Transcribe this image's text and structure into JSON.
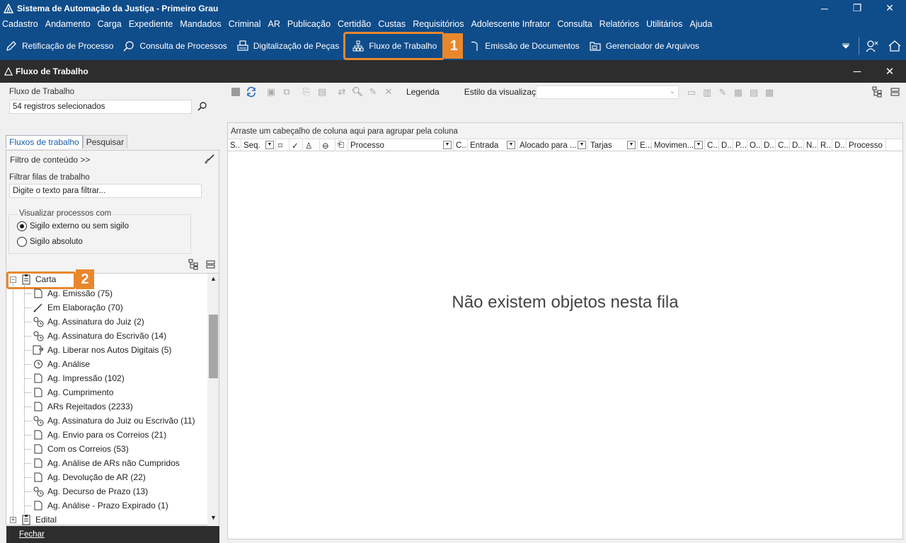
{
  "window": {
    "title": "Sistema de Automação da Justiça - Primeiro Grau",
    "minimize": "─",
    "restore": "❐",
    "close": "✕"
  },
  "menu": [
    "Cadastro",
    "Andamento",
    "Carga",
    "Expediente",
    "Mandados",
    "Criminal",
    "AR",
    "Publicação",
    "Certidão",
    "Custas",
    "Requisitórios",
    "Adolescente Infrator",
    "Consulta",
    "Relatórios",
    "Utilitários",
    "Ajuda"
  ],
  "toolbar": {
    "items": [
      {
        "label": "Retificação de Processo",
        "icon": "edit-icon"
      },
      {
        "label": "Consulta de Processos",
        "icon": "search-icon"
      },
      {
        "label": "Digitalização de Peças",
        "icon": "scanner-icon"
      },
      {
        "label": "Fluxo de Trabalho",
        "icon": "workflow-icon"
      },
      {
        "label": "Emissão de Documentos",
        "icon": "document-icon"
      },
      {
        "label": "Gerenciador de Arquivos",
        "icon": "folder-icon"
      }
    ],
    "badge1": "1"
  },
  "subwindow": {
    "title": "Fluxo de Trabalho",
    "minimize": "─",
    "close": "✕"
  },
  "left": {
    "fluxo_label": "Fluxo de Trabalho",
    "fluxo_value": "54 registros selecionados",
    "tab_fluxos": "Fluxos de trabalho",
    "tab_pesquisar": "Pesquisar",
    "filtro_conteudo": "Filtro de conteúdo >>",
    "filtrar_label": "Filtrar filas de trabalho",
    "filtrar_placeholder": "Digite o texto para filtrar...",
    "visualizar_legend": "Visualizar processos com",
    "radio1": "Sigilo externo ou sem sigilo",
    "radio2": "Sigilo absoluto",
    "badge2": "2",
    "tree_root": "Carta",
    "tree_items": [
      {
        "label": "Ag. Emissão (75)",
        "icon": "page-icon"
      },
      {
        "label": "Em Elaboração (70)",
        "icon": "pen-icon"
      },
      {
        "label": "Ag. Assinatura do Juiz (2)",
        "icon": "signature-icon"
      },
      {
        "label": "Ag. Assinatura do Escrivão (14)",
        "icon": "signature-icon"
      },
      {
        "label": "Ag. Liberar nos Autos Digitais (5)",
        "icon": "release-icon"
      },
      {
        "label": "Ag. Análise",
        "icon": "clock-icon"
      },
      {
        "label": "Ag. Impressão (102)",
        "icon": "page-icon"
      },
      {
        "label": "Ag. Cumprimento",
        "icon": "page-icon"
      },
      {
        "label": "ARs Rejeitados (2233)",
        "icon": "page-icon"
      },
      {
        "label": "Ag. Assinatura do Juiz ou Escrivão (11)",
        "icon": "signature-icon"
      },
      {
        "label": "Ag. Envio para os Correios (21)",
        "icon": "page-icon"
      },
      {
        "label": "Com os Correios (53)",
        "icon": "page-icon"
      },
      {
        "label": "Ag. Análise de ARs não Cumpridos",
        "icon": "page-icon"
      },
      {
        "label": "Ag. Devolução de AR (22)",
        "icon": "page-icon"
      },
      {
        "label": "Ag. Decurso de Prazo (13)",
        "icon": "timer-icon"
      },
      {
        "label": "Ag. Análise - Prazo Expirado (1)",
        "icon": "page-icon"
      }
    ],
    "tree_next": "Edital",
    "fechar": "Fechar"
  },
  "right": {
    "legenda": "Legenda",
    "estilo_label": "Estilo da visualização",
    "group_hint": "Arraste um cabeçalho de coluna aqui para agrupar pela coluna",
    "columns": [
      "S...",
      "Seq.",
      "",
      "",
      "",
      "",
      "",
      "Processo",
      "C...",
      "Entrada",
      "Alocado para ...",
      "Tarjas",
      "E...",
      "Movimen...",
      "C...",
      "D...",
      "P...",
      "O...",
      "D...",
      "C...",
      "D...",
      "N...",
      "R...",
      "D...",
      "Processo"
    ],
    "empty_message": "Não existem objetos nesta fila"
  }
}
